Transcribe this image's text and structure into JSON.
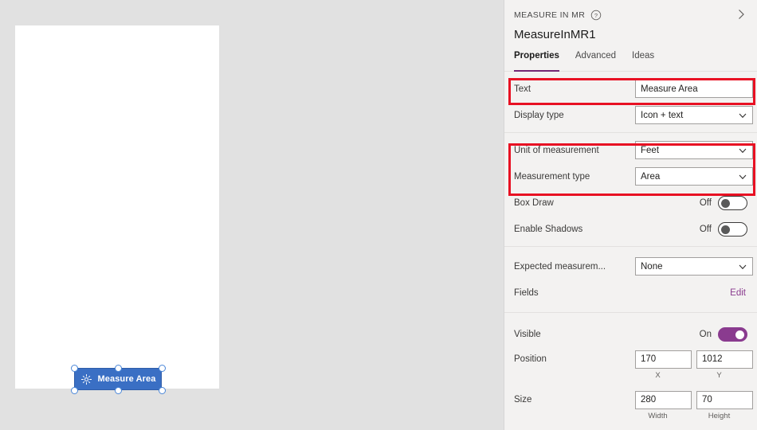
{
  "panel": {
    "eyebrow": "MEASURE IN MR",
    "help_icon": "help-circle-icon",
    "collapse_icon": "chevron-right-icon",
    "control_name": "MeasureInMR1",
    "tabs": [
      {
        "label": "Properties",
        "active": true
      },
      {
        "label": "Advanced",
        "active": false
      },
      {
        "label": "Ideas",
        "active": false
      }
    ],
    "accent_color": "#742774",
    "highlight_color": "#e81123",
    "sections": [
      {
        "rows": [
          {
            "type": "text",
            "label": "Text",
            "value": "Measure Area"
          },
          {
            "type": "dropdown",
            "label": "Display type",
            "value": "Icon + text"
          }
        ]
      },
      {
        "rows": [
          {
            "type": "dropdown",
            "label": "Unit of measurement",
            "value": "Feet"
          },
          {
            "type": "dropdown",
            "label": "Measurement type",
            "value": "Area"
          },
          {
            "type": "toggle",
            "label": "Box Draw",
            "state": "Off",
            "on": false
          },
          {
            "type": "toggle",
            "label": "Enable Shadows",
            "state": "Off",
            "on": false
          }
        ]
      },
      {
        "rows": [
          {
            "type": "dropdown",
            "label": "Expected measurem...",
            "value": "None"
          },
          {
            "type": "link",
            "label": "Fields",
            "action": "Edit"
          }
        ]
      },
      {
        "rows": [
          {
            "type": "toggle",
            "label": "Visible",
            "state": "On",
            "on": true
          },
          {
            "type": "pair",
            "label": "Position",
            "fields": [
              {
                "value": "170",
                "sub": "X"
              },
              {
                "value": "1012",
                "sub": "Y"
              }
            ]
          },
          {
            "type": "pair",
            "label": "Size",
            "fields": [
              {
                "value": "280",
                "sub": "Width"
              },
              {
                "value": "70",
                "sub": "Height"
              }
            ]
          }
        ]
      }
    ]
  },
  "canvas": {
    "background_color": "#e1e1e1",
    "screen_color": "#ffffff",
    "selected_control": {
      "label": "Measure Area",
      "icon": "measure-target-icon",
      "fill_color": "#3a6fc4",
      "text_color": "#ffffff",
      "selection_handle_color": "#4a86d8"
    }
  },
  "rows": {
    "text": {
      "label": "Text",
      "value": "Measure Area"
    },
    "display_type": {
      "label": "Display type",
      "value": "Icon + text"
    },
    "unit": {
      "label": "Unit of measurement",
      "value": "Feet"
    },
    "measurement_type": {
      "label": "Measurement type",
      "value": "Area"
    },
    "box_draw": {
      "label": "Box Draw",
      "state": "Off"
    },
    "shadows": {
      "label": "Enable Shadows",
      "state": "Off"
    },
    "expected": {
      "label": "Expected measurem...",
      "value": "None"
    },
    "fields": {
      "label": "Fields",
      "action": "Edit"
    },
    "visible": {
      "label": "Visible",
      "state": "On"
    },
    "position": {
      "label": "Position",
      "x": "170",
      "y": "1012",
      "x_sub": "X",
      "y_sub": "Y"
    },
    "size": {
      "label": "Size",
      "w": "280",
      "h": "70",
      "w_sub": "Width",
      "h_sub": "Height"
    }
  }
}
